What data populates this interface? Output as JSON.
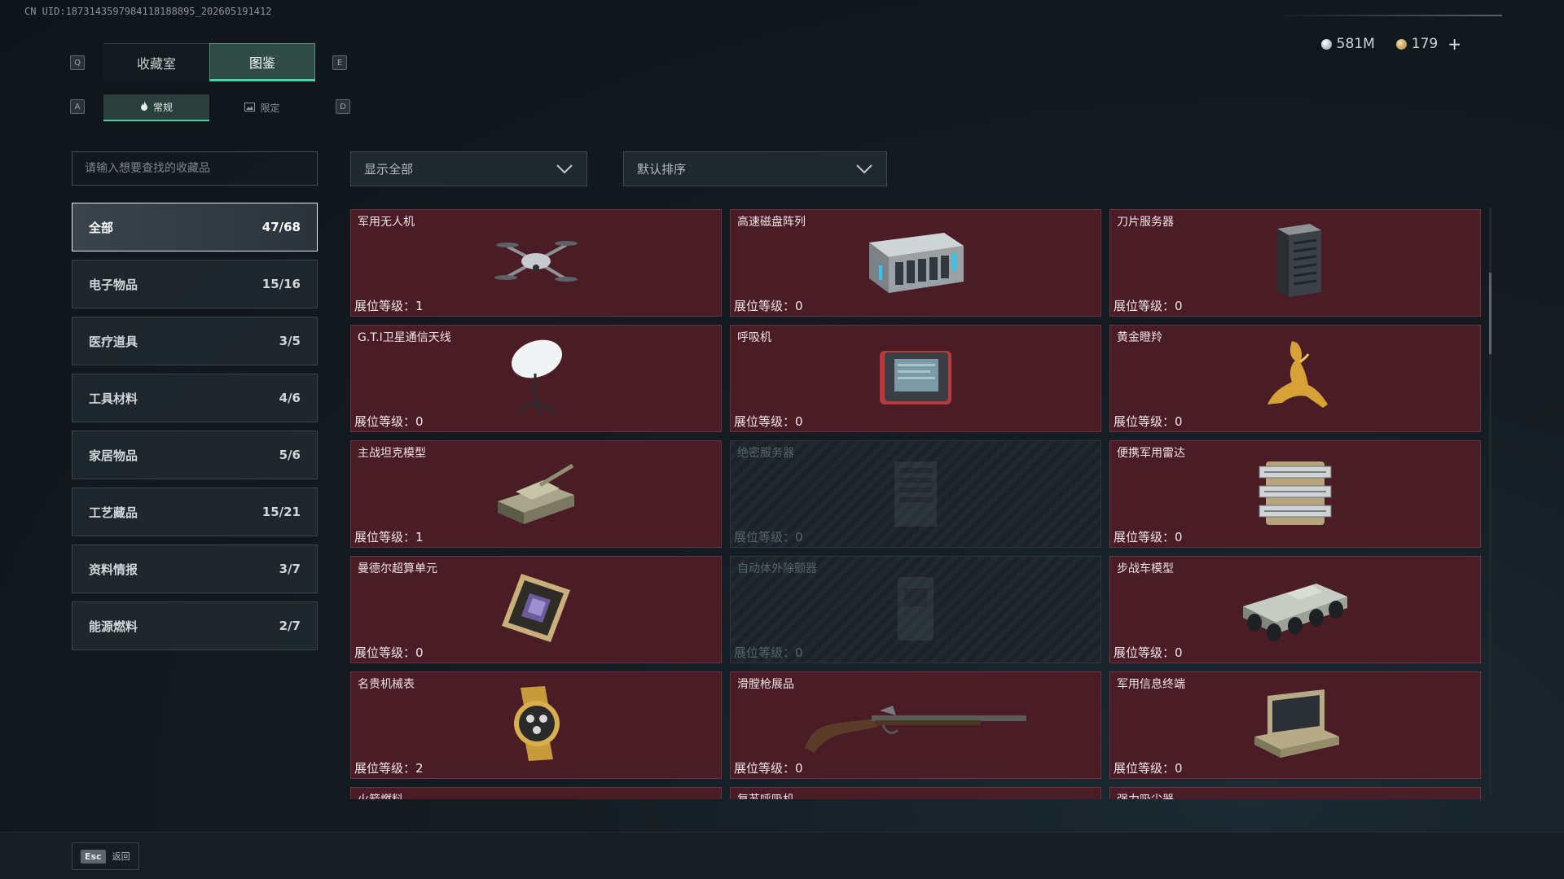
{
  "uid": "CN UID:1873143597984118188895_202605191412",
  "keys": {
    "q": "Q",
    "e": "E",
    "a": "A",
    "d": "D"
  },
  "tabs": [
    {
      "label": "收藏室",
      "active": false
    },
    {
      "label": "图鉴",
      "active": true
    }
  ],
  "subtabs": [
    {
      "label": "常规",
      "icon": "flame-icon",
      "active": true
    },
    {
      "label": "限定",
      "icon": "image-icon",
      "active": false
    }
  ],
  "currency": {
    "silver": "581M",
    "gold": "179",
    "plus": "+"
  },
  "search": {
    "placeholder": "请输入想要查找的收藏品"
  },
  "filters": {
    "show": "显示全部",
    "sort": "默认排序"
  },
  "categories": [
    {
      "label": "全部",
      "count": "47/68",
      "active": true
    },
    {
      "label": "电子物品",
      "count": "15/16"
    },
    {
      "label": "医疗道具",
      "count": "3/5"
    },
    {
      "label": "工具材料",
      "count": "4/6"
    },
    {
      "label": "家居物品",
      "count": "5/6"
    },
    {
      "label": "工艺藏品",
      "count": "15/21"
    },
    {
      "label": "资料情报",
      "count": "3/7"
    },
    {
      "label": "能源燃料",
      "count": "2/7"
    }
  ],
  "items": [
    {
      "name": "军用无人机",
      "level": "展位等级：1",
      "icon": "drone-icon",
      "locked": false
    },
    {
      "name": "高速磁盘阵列",
      "level": "展位等级：0",
      "icon": "disk-array-icon",
      "locked": false
    },
    {
      "name": "刀片服务器",
      "level": "展位等级：0",
      "icon": "blade-server-icon",
      "locked": false
    },
    {
      "name": "G.T.I卫星通信天线",
      "level": "展位等级：0",
      "icon": "satellite-dish-icon",
      "locked": false
    },
    {
      "name": "呼吸机",
      "level": "展位等级：0",
      "icon": "ventilator-icon",
      "locked": false
    },
    {
      "name": "黄金瞪羚",
      "level": "展位等级：0",
      "icon": "gold-gazelle-icon",
      "locked": false
    },
    {
      "name": "主战坦克模型",
      "level": "展位等级：1",
      "icon": "tank-icon",
      "locked": false
    },
    {
      "name": "绝密服务器",
      "level": "展位等级：0",
      "icon": "server-icon",
      "locked": true
    },
    {
      "name": "便携军用雷达",
      "level": "展位等级：0",
      "icon": "radar-icon",
      "locked": false
    },
    {
      "name": "曼德尔超算单元",
      "level": "展位等级：0",
      "icon": "chip-icon",
      "locked": false
    },
    {
      "name": "自动体外除颤器",
      "level": "展位等级：0",
      "icon": "defibrillator-icon",
      "locked": true
    },
    {
      "name": "步战车模型",
      "level": "展位等级：0",
      "icon": "ifv-icon",
      "locked": false
    },
    {
      "name": "名贵机械表",
      "level": "展位等级：2",
      "icon": "watch-icon",
      "locked": false
    },
    {
      "name": "滑膛枪展品",
      "level": "展位等级：0",
      "icon": "musket-icon",
      "locked": false
    },
    {
      "name": "军用信息终端",
      "level": "展位等级：0",
      "icon": "terminal-icon",
      "locked": false
    },
    {
      "name": "火箭燃料",
      "level": "",
      "icon": "fuel-icon",
      "locked": false
    },
    {
      "name": "复苏呼吸机",
      "level": "",
      "icon": "ventilator-icon",
      "locked": false
    },
    {
      "name": "强力吸尘器",
      "level": "",
      "icon": "vacuum-icon",
      "locked": false
    }
  ],
  "footer": {
    "esc_key": "Esc",
    "esc_label": "返回"
  }
}
